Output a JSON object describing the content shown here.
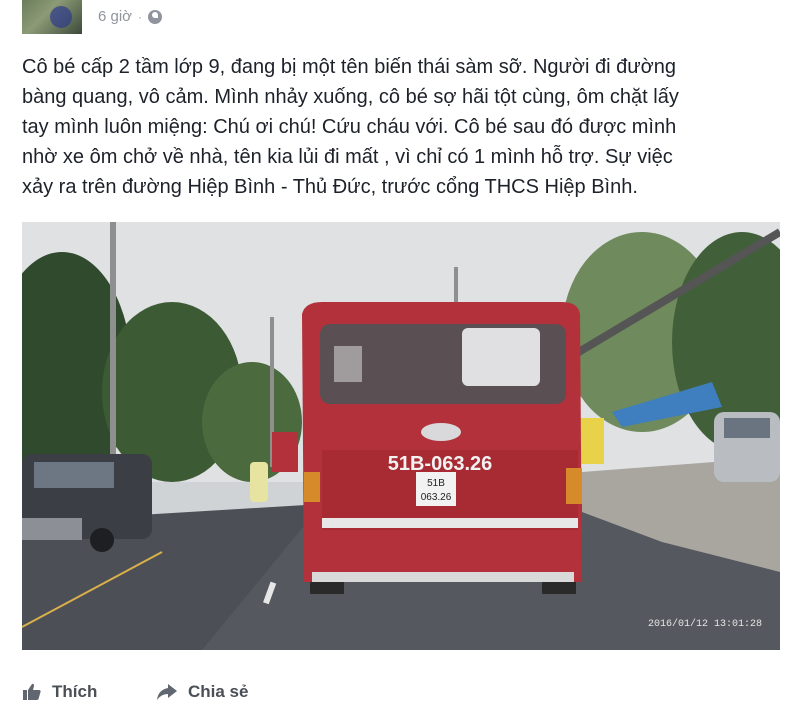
{
  "post": {
    "time": "6 giờ",
    "separator": "·",
    "privacy_icon": "globe-icon",
    "text_lines": [
      "Cô bé cấp 2 tầm lớp 9, đang bị một tên biến thái sàm sỡ. Người đi đường",
      "bàng quang, vô cảm. Mình nhảy xuống, cô bé sợ hãi tột cùng, ôm chặt lấy",
      "tay mình luôn miệng: Chú ơi chú! Cứu cháu với. Cô bé sau đó được mình",
      "nhờ xe ôm chở về nhà, tên kia lủi đi mất , vì chỉ có 1 mình hỗ trợ. Sự việc",
      "xảy ra trên đường Hiệp Bình - Thủ Đức, trước cổng THCS Hiệp Bình."
    ]
  },
  "photo": {
    "plate_main": "51B-063.26",
    "plate_small_top": "51B",
    "plate_small_bottom": "063.26",
    "timestamp": "2016/01/12  13:01:28",
    "bus_color": "#b3313a"
  },
  "actions": {
    "like_label": "Thích",
    "share_label": "Chia sẻ",
    "like_icon": "thumbs-up-icon",
    "share_icon": "share-arrow-icon"
  }
}
